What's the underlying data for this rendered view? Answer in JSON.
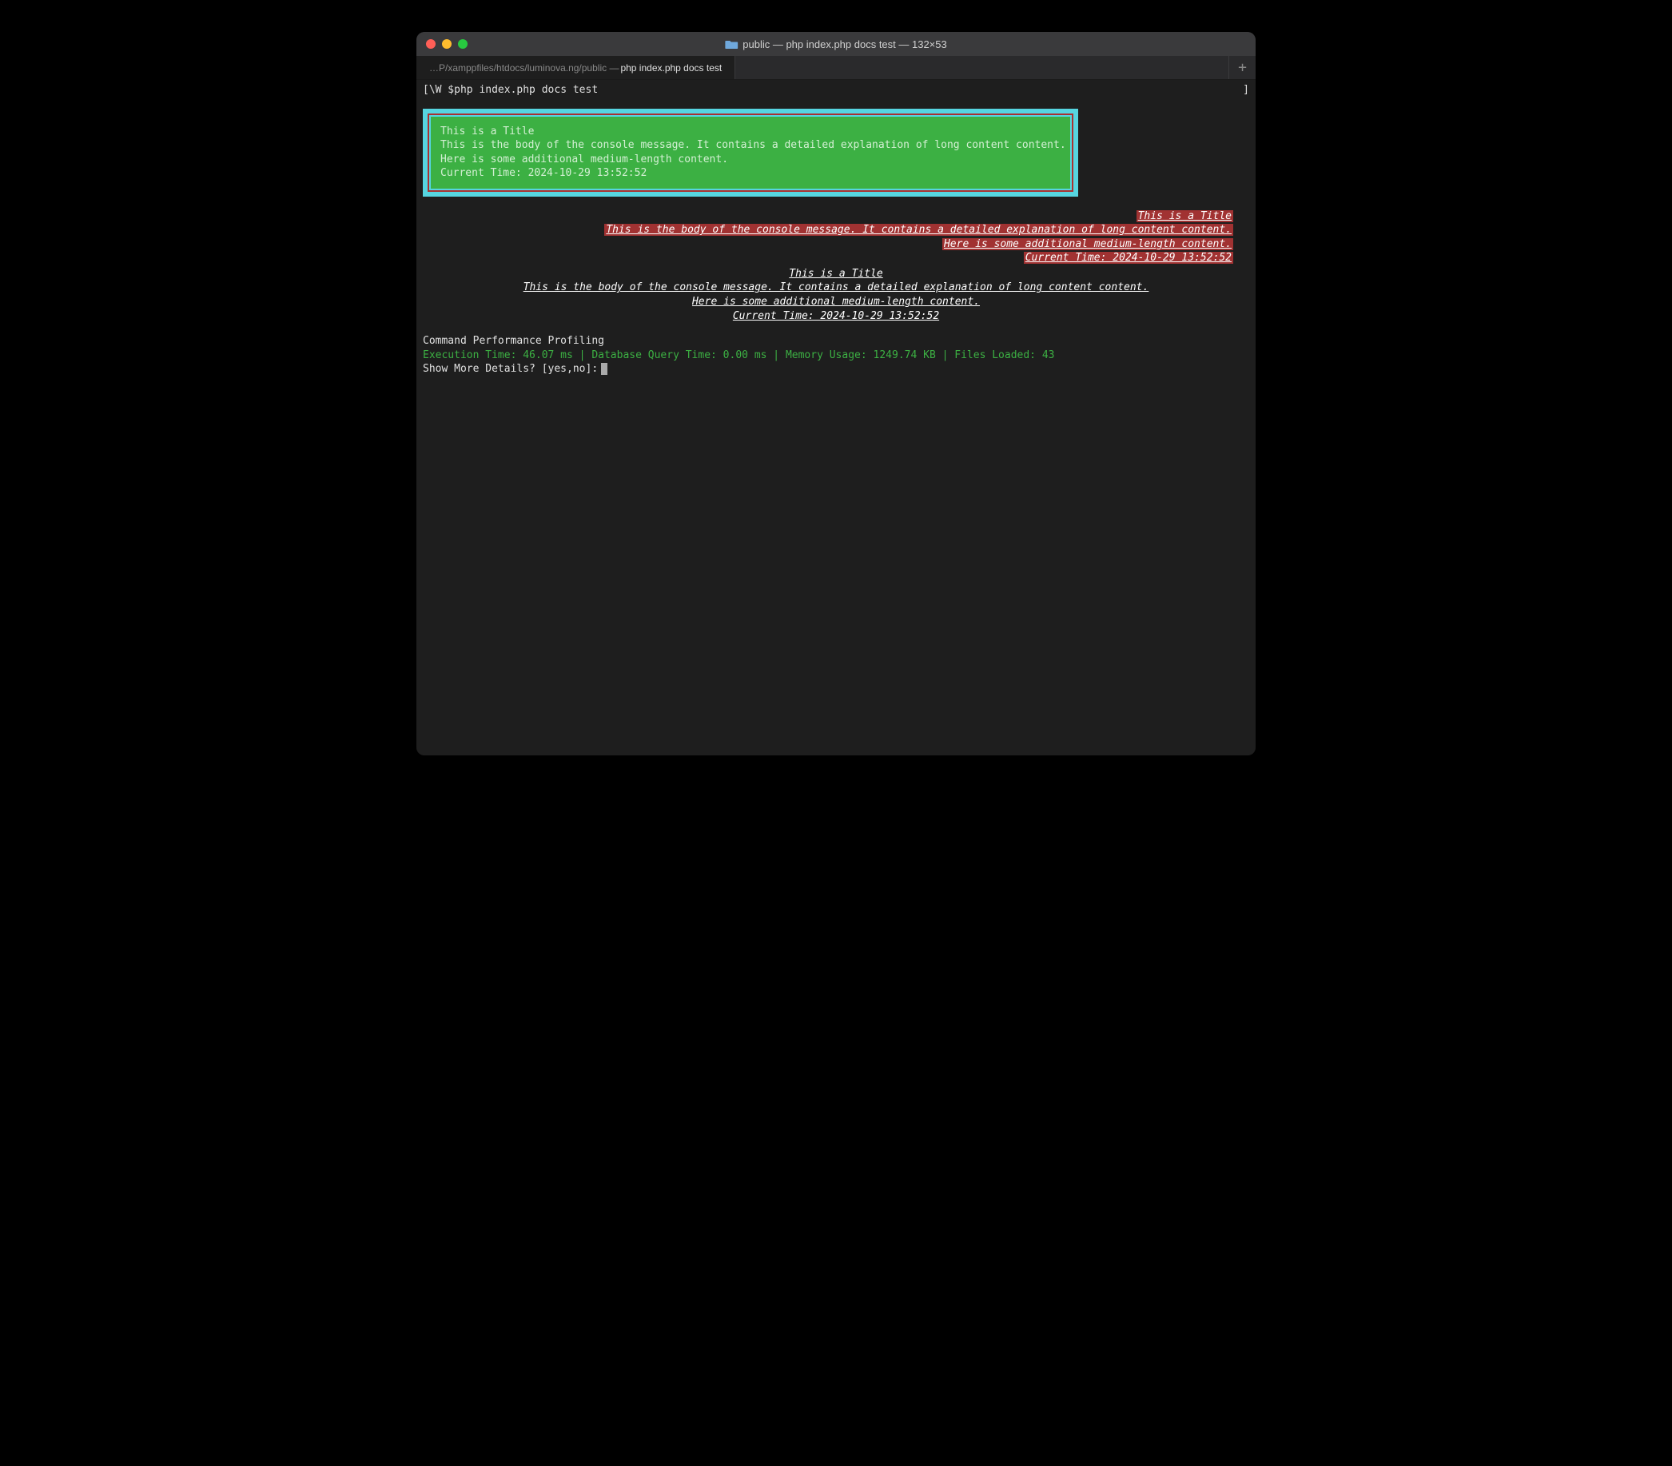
{
  "titlebar": {
    "title": "public — php index.php docs test — 132×53"
  },
  "tab": {
    "path": "…P/xamppfiles/htdocs/luminova.ng/public —",
    "cmd": "php index.php docs test"
  },
  "prompt": {
    "lbracket": "[",
    "text": "\\W $php index.php docs test",
    "rbracket": "]"
  },
  "greenbox": {
    "line1": "This is a Title",
    "line2": "This is the body of the console message. It contains a detailed explanation of long content content.",
    "line3": "Here is some additional medium-length content.",
    "line4": "Current Time: 2024-10-29 13:52:52"
  },
  "redblock": {
    "line1": "This is a Title",
    "line2": "This is the body of the console message. It contains a detailed explanation of long content content.",
    "line3": "Here is some additional medium-length content.",
    "line4": "Current Time: 2024-10-29 13:52:52"
  },
  "centerblock": {
    "line1": "This is a Title",
    "line2": "This is the body of the console message. It contains a detailed explanation of long content content.",
    "line3": "Here is some additional medium-length content.",
    "line4": "Current Time: 2024-10-29 13:52:52"
  },
  "perf": {
    "title": "Command Performance Profiling",
    "line": "Execution Time: 46.07 ms  |  Database Query Time: 0.00 ms  |  Memory Usage: 1249.74 KB  |  Files Loaded: 43",
    "question": "Show More Details? [yes,no]:"
  },
  "add_button": "+"
}
